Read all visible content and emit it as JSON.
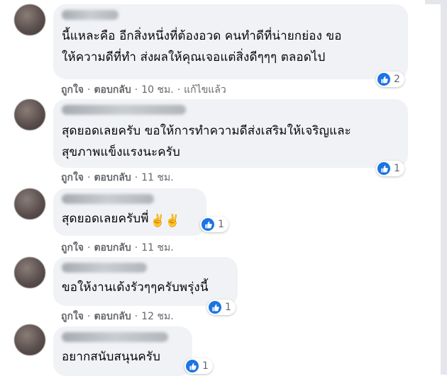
{
  "comments": [
    {
      "text": "นี้แหละคือ อีกสิ่งหนึ่งที่ต้องอวด คนทำดีที่น่ายกย่อง ขอ\nให้ความดีที่ทำ ส่งผลให้คุณเจอแต่สิ่งดีๆๆๆ ตลอดไป",
      "reactions": "2",
      "like": "ถูกใจ",
      "reply": "ตอบกลับ",
      "time": "10 ชม.",
      "edited": "แก้ไขแล้ว"
    },
    {
      "text": "สุดยอดเลยครับ ขอให้การทำความดีส่งเสริมให้เจริญและ\nสุขภาพแข็งแรงนะครับ",
      "reactions": "1",
      "like": "ถูกใจ",
      "reply": "ตอบกลับ",
      "time": "11 ชม."
    },
    {
      "text": "สุดยอดเลยครับพี่",
      "emoji": "✌️✌️",
      "reactions": "1",
      "like": "ถูกใจ",
      "reply": "ตอบกลับ",
      "time": "11 ชม."
    },
    {
      "text": "ขอให้งานเด้งรัวๆๆครับพรุ่งนี้",
      "reactions": "1",
      "like": "ถูกใจ",
      "reply": "ตอบกลับ",
      "time": "12 ชม."
    },
    {
      "text": "อยากสนับสนุนครับ",
      "reactions": "1"
    }
  ],
  "colors": {
    "bubble": "#f0f2f5",
    "meta_text": "#65676b",
    "like_blue": "#1b74e4"
  },
  "icons": {
    "reaction": "like-thumb-icon",
    "avatar": "avatar"
  }
}
